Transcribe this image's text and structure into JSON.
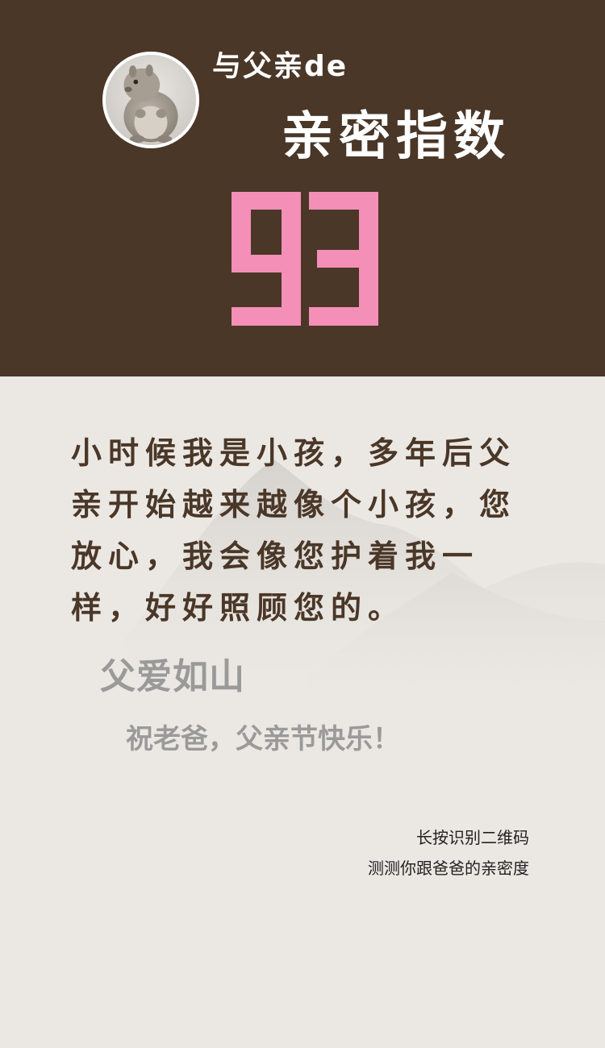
{
  "header": {
    "avatar": "squirrel-photo",
    "title_line1": "与父亲de",
    "title_line2": "亲密指数",
    "score": "93",
    "score_color": "#f48fb8",
    "background_color": "#4a3728"
  },
  "message": {
    "text": "小时候我是小孩，多年后父亲开始越来越像个小孩，您放心，我会像您护着我一样，好好照顾您的。",
    "color": "#4a3728"
  },
  "motto": {
    "line1": "父爱如山",
    "line2": "祝老爸，父亲节快乐！",
    "color": "#9a9a9a"
  },
  "qr_hint": {
    "line1": "长按识别二维码",
    "line2": "测测你跟爸爸的亲密度"
  }
}
